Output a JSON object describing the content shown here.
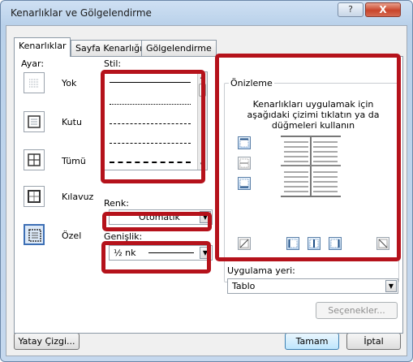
{
  "window": {
    "title": "Kenarlıklar ve Gölgelendirme",
    "help_label": "?",
    "close_label": "X"
  },
  "tabs": [
    {
      "label": "Kenarlıklar"
    },
    {
      "label": "Sayfa Kenarlığı"
    },
    {
      "label": "Gölgelendirme"
    }
  ],
  "settings": {
    "label": "Ayar:",
    "items": [
      {
        "label": "Yok"
      },
      {
        "label": "Kutu"
      },
      {
        "label": "Tümü"
      },
      {
        "label": "Kılavuz"
      },
      {
        "label": "Özel"
      }
    ],
    "selected": "Özel"
  },
  "style": {
    "label": "Stil:",
    "scroll_up": "▲",
    "scroll_down": "▼",
    "line_styles": [
      "solid",
      "dotted",
      "dashed-small",
      "dashed",
      "dash-dot"
    ],
    "selected": "solid"
  },
  "color": {
    "label": "Renk:",
    "value": "Otomatik",
    "dropdown_glyph": "▼"
  },
  "width": {
    "label": "Genişlik:",
    "value": "½ nk",
    "dropdown_glyph": "▼"
  },
  "preview": {
    "title": "Önizleme",
    "hint": "Kenarlıkları uygulamak için aşağıdaki çizimi tıklatın ya da düğmeleri kullanın"
  },
  "apply_to": {
    "label": "Uygulama yeri:",
    "value": "Tablo",
    "dropdown_glyph": "▼"
  },
  "buttons": {
    "options": "Seçenekler...",
    "horizontal_line": "Yatay Çizgi...",
    "ok": "Tamam",
    "cancel": "İptal"
  },
  "colors": {
    "highlight": "#b5121b",
    "accent": "#3d6fb5"
  }
}
